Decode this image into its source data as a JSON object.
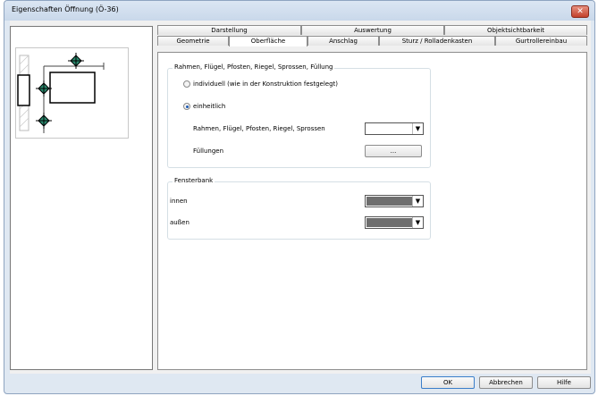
{
  "window": {
    "title": "Eigenschaften Öffnung (Ö-36)",
    "close_glyph": "✕"
  },
  "tabs": {
    "row1": [
      "Darstellung",
      "Auswertung",
      "Objektsichtbarkeit"
    ],
    "row2": [
      "Geometrie",
      "Oberfläche",
      "Anschlag",
      "Sturz / Rolladenkasten",
      "Gurtrollereinbau"
    ],
    "active": "Oberfläche"
  },
  "group_surface": {
    "title": "Rahmen, Flügel, Pfosten, Riegel, Sprossen, Füllung",
    "option_individual": "individuell (wie in der Konstruktion festgelegt)",
    "option_uniform": "einheitlich",
    "selected": "einheitlich",
    "frame_label": "Rahmen, Flügel, Pfosten, Riegel, Sprossen",
    "frame_color": "#ffffff",
    "fill_label": "Füllungen",
    "fill_button": "..."
  },
  "group_sill": {
    "title": "Fensterbank",
    "inside_label": "innen",
    "inside_color": "#6e6e6e",
    "outside_label": "außen",
    "outside_color": "#6e6e6e"
  },
  "buttons": {
    "ok": "OK",
    "cancel": "Abbrechen",
    "help": "Hilfe"
  },
  "icons": {
    "close": "close-icon",
    "dropdown": "dropdown-arrow-icon"
  }
}
